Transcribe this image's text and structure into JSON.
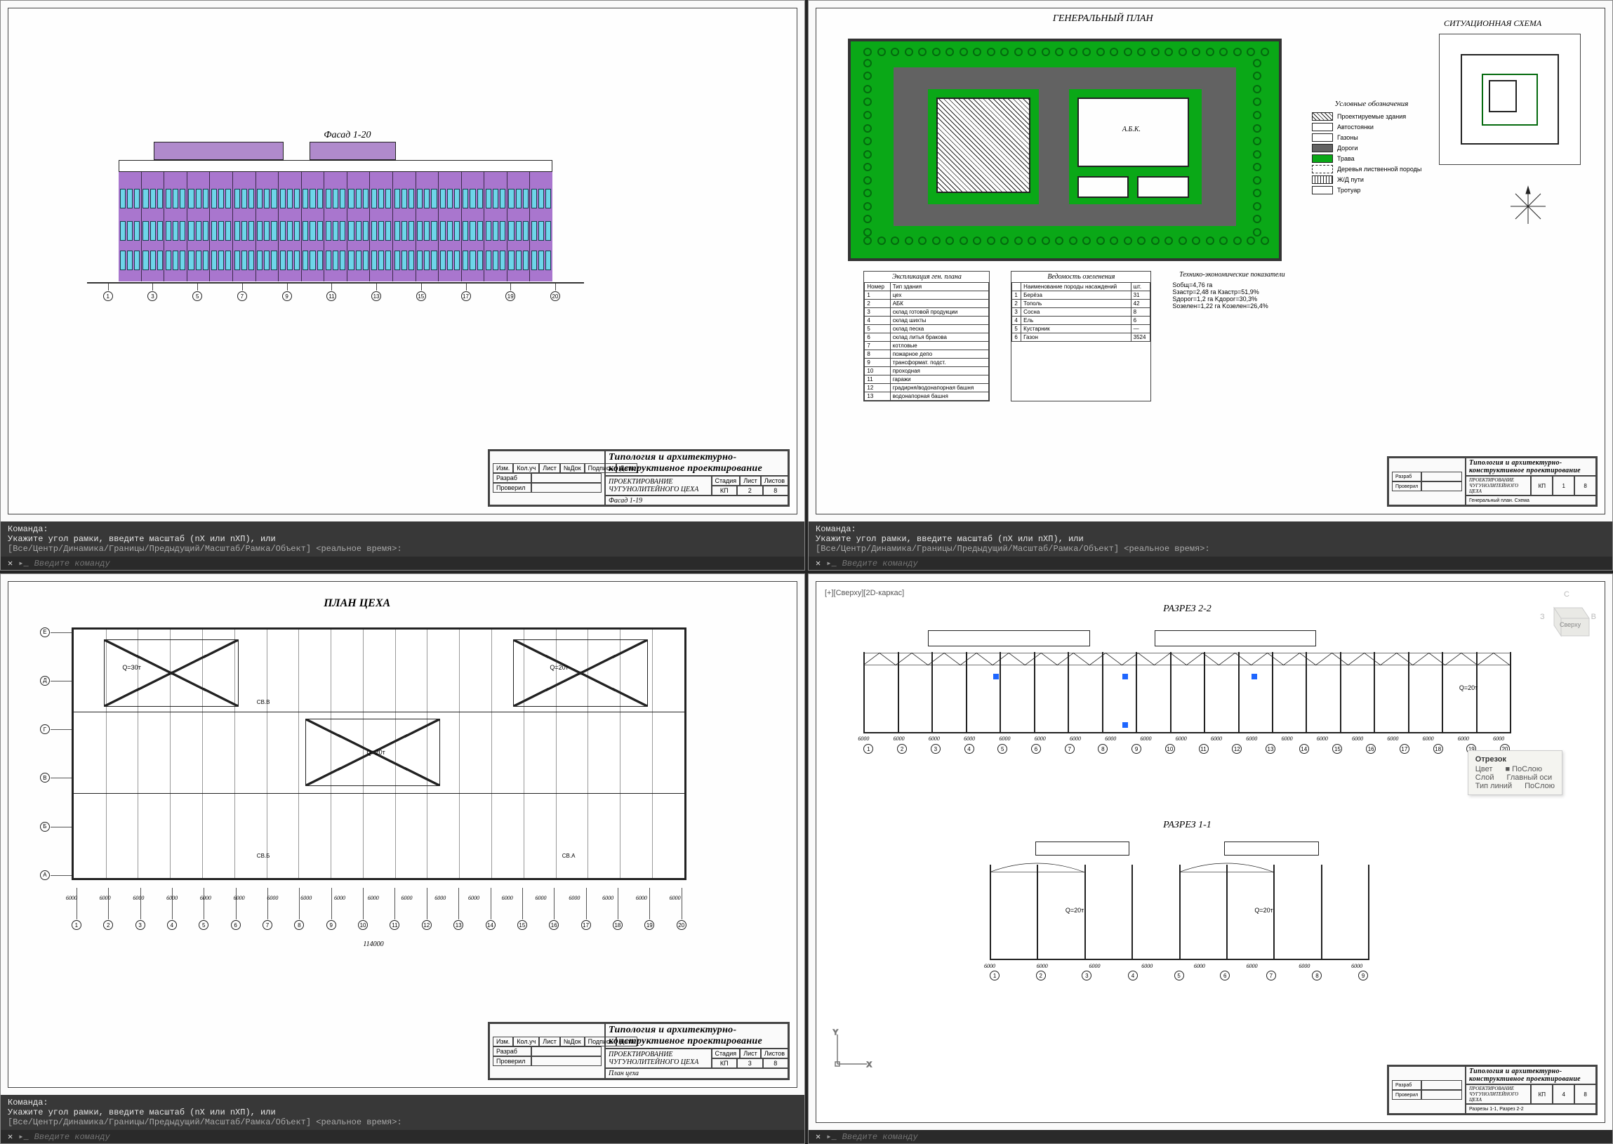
{
  "command": {
    "label": "Команда:",
    "line1": "Укажите угол рамки, введите масштаб (nX или nXП), или",
    "line2": "[Все/Центр/Динамика/Границы/Предыдущий/Масштаб/Рамка/Объект] <реальное время>:",
    "placeholder": "Введите команду"
  },
  "titleblock": {
    "course": "Типология и архитектурно-конструктивное проектирование",
    "project": "ПРОЕКТИРОВАНИЕ ЧУГУНОЛИТЕЙНОГО ЦЕХА",
    "cols": [
      "Изм.",
      "Кол.уч",
      "Лист",
      "№Док",
      "Подпись",
      "Дата"
    ],
    "rows": [
      "Разраб",
      "Проверил"
    ],
    "stage_h": "Стадия",
    "sheet_h": "Лист",
    "sheets_h": "Листов",
    "stage": "КП",
    "total": "8"
  },
  "sheet1": {
    "facade_title": "Фасад 1-20",
    "block_caption": "Фасад 1-19",
    "sheet_no": "2",
    "axes": [
      "1",
      "3",
      "5",
      "7",
      "9",
      "11",
      "13",
      "15",
      "17",
      "19",
      "20"
    ]
  },
  "sheet2": {
    "gp_title": "ГЕНЕРАЛЬНЫЙ ПЛАН",
    "sit_title": "СИТУАЦИОННАЯ СХЕМА",
    "sheet_no": "1",
    "block_caption": "Генеральный план. Схема",
    "main_label": "А.Б.К.",
    "legend_title": "Условные обозначения",
    "legend": [
      {
        "c": "repeating-linear-gradient(45deg,#fff 0 3px,#222 3px 4px)",
        "t": "Проектируемые здания"
      },
      {
        "c": "#fff",
        "t": "Автостоянки"
      },
      {
        "c": "#fff",
        "t": "Газоны"
      },
      {
        "c": "#626262",
        "t": "Дороги"
      },
      {
        "c": "#0aa817",
        "t": "Трава"
      },
      {
        "c": "#fff",
        "border": "1px dashed #222",
        "t": "Деревья лиственной породы"
      },
      {
        "c": "repeating-linear-gradient(90deg,#fff 0 3px,#222 3px 4px)",
        "t": "Ж/Д пути"
      },
      {
        "c": "#fff",
        "t": "Тротуар"
      }
    ],
    "expl_title": "Экспликация ген. плана",
    "expl_h": [
      "Номер",
      "Тип здания"
    ],
    "expl": [
      [
        "1",
        "цех"
      ],
      [
        "2",
        "АБК"
      ],
      [
        "3",
        "склад готовой продукции"
      ],
      [
        "4",
        "склад шихты"
      ],
      [
        "5",
        "склад песка"
      ],
      [
        "6",
        "склад литья бракова"
      ],
      [
        "7",
        "котловые"
      ],
      [
        "8",
        "пожарное депо"
      ],
      [
        "9",
        "трансформат. подст."
      ],
      [
        "10",
        "проходная"
      ],
      [
        "11",
        "гаражи"
      ],
      [
        "12",
        "градирня/водонапорная башня"
      ],
      [
        "13",
        "водонапорная башня"
      ]
    ],
    "ved_title": "Ведомость озеленения",
    "ved_h": [
      "",
      "Наименование породы насаждений",
      "шт."
    ],
    "ved": [
      [
        "1",
        "Берёза",
        "31"
      ],
      [
        "2",
        "Тополь",
        "42"
      ],
      [
        "3",
        "Сосна",
        "8"
      ],
      [
        "4",
        "Ель",
        "6"
      ],
      [
        "5",
        "Кустарник",
        "—"
      ],
      [
        "6",
        "Газон",
        "3524"
      ]
    ],
    "tep_title": "Технико-экономические показатели",
    "tep": [
      "Sобщ=4,76 га",
      "Sзастр=2,48 га   Кзастр=51,9%",
      "Sдорог=1,2 га   Kдорог=30,3%",
      "Sозелен=1,22 га   Kозелен=26,4%"
    ]
  },
  "sheet3": {
    "title": "ПЛАН ЦЕХА",
    "sheet_no": "3",
    "block_caption": "План цеха",
    "h_axes": [
      "1",
      "2",
      "3",
      "4",
      "5",
      "6",
      "7",
      "8",
      "9",
      "10",
      "11",
      "12",
      "13",
      "14",
      "15",
      "16",
      "17",
      "18",
      "19",
      "20"
    ],
    "v_axes": [
      "Е",
      "Д",
      "Г",
      "В",
      "Б",
      "А"
    ],
    "span_dims": [
      "6000",
      "6000",
      "6000",
      "6000",
      "6000",
      "6000",
      "6000",
      "6000",
      "6000",
      "6000",
      "6000",
      "6000",
      "6000",
      "6000",
      "6000",
      "6000",
      "6000",
      "6000",
      "6000"
    ],
    "total_dim": "114000",
    "crane1": "Q=30т",
    "crane2": "Q=20т",
    "crane3": "Q=20т",
    "sb1": "СВ.В",
    "sb2": "СВ.Б",
    "sb3": "СВ.А"
  },
  "sheet4": {
    "vp": "[+][Сверху][2D-каркас]",
    "sec22": "РАЗРЕЗ 2-2",
    "sec11": "РАЗРЕЗ 1-1",
    "sheet_no": "4",
    "block_caption": "Разрезы 1-1, Разрез 2-2",
    "crane": "Q=20т",
    "dims": [
      "6000",
      "6000",
      "6000",
      "6000",
      "6000",
      "6000",
      "6000",
      "6000",
      "6000",
      "6000",
      "6000",
      "6000",
      "6000",
      "6000",
      "6000",
      "6000",
      "6000",
      "6000",
      "6000"
    ],
    "axes22": [
      "1",
      "2",
      "3",
      "4",
      "5",
      "6",
      "7",
      "8",
      "9",
      "10",
      "11",
      "12",
      "13",
      "14",
      "15",
      "16",
      "17",
      "18",
      "19",
      "20"
    ],
    "dims11": [
      "6000",
      "6000",
      "6000",
      "6000",
      "6000",
      "6000",
      "6000",
      "6000"
    ],
    "axes11": [
      "1",
      "2",
      "3",
      "4",
      "5",
      "6",
      "7",
      "8",
      "9"
    ],
    "viewcube": {
      "top": "С",
      "left": "З",
      "right": "В",
      "face": "Сверху"
    },
    "tooltip": {
      "h": "Отрезок",
      "r": [
        [
          "Цвет",
          "■ ПоСлою"
        ],
        [
          "Слой",
          "Главный оси"
        ],
        [
          "Тип линий",
          "ПоСлою"
        ]
      ]
    }
  }
}
